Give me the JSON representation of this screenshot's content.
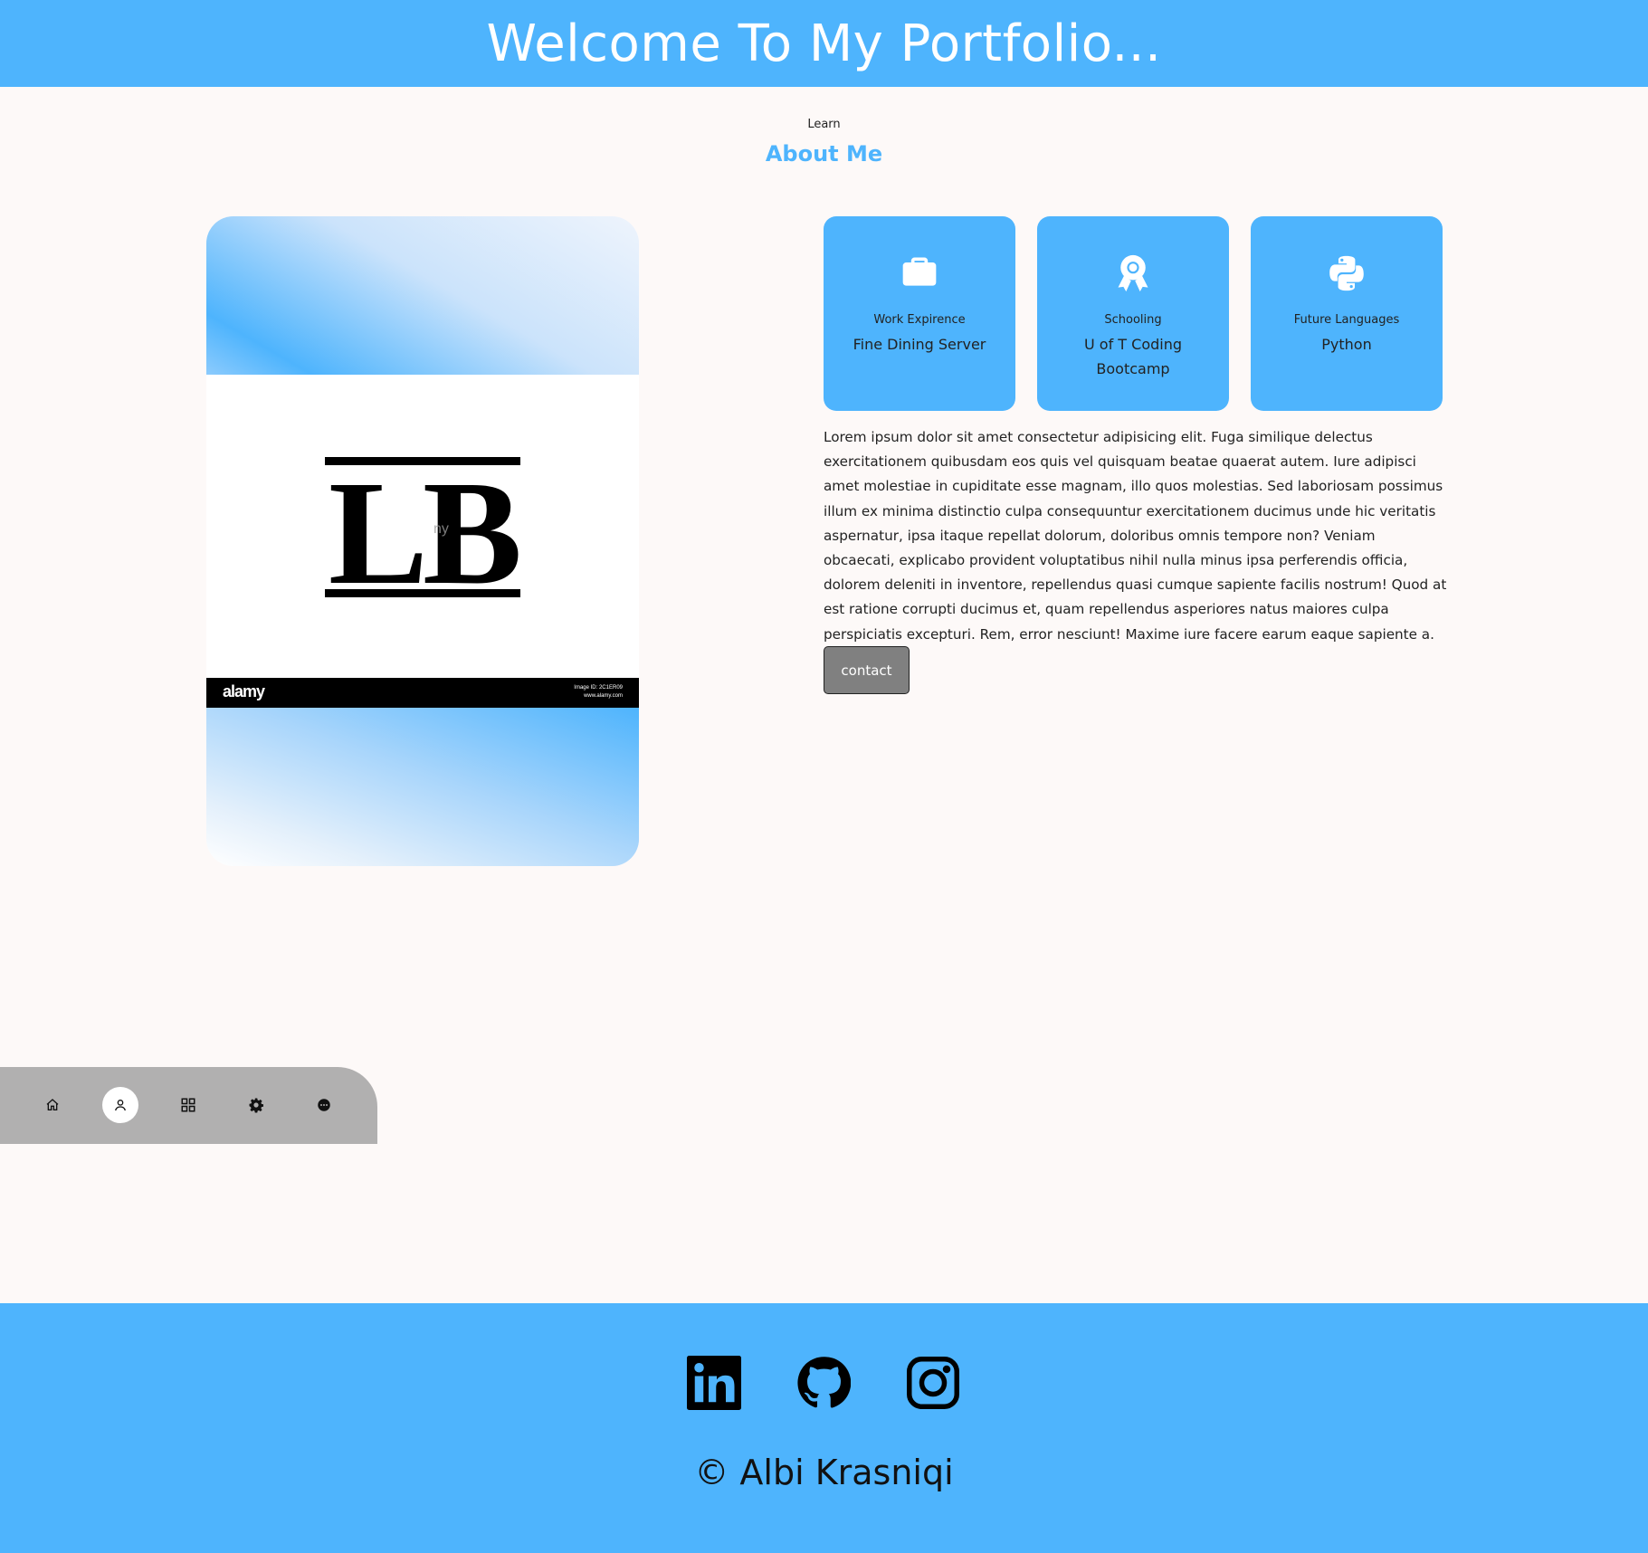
{
  "header": {
    "title": "Welcome To My Portfolio..."
  },
  "about": {
    "kicker": "Learn",
    "title": "About Me",
    "photo": {
      "logo_text": "LB",
      "watermark": "alamy",
      "brand": "alamy",
      "image_id": "Image ID: 2C1ER09",
      "site": "www.alamy.com"
    },
    "cards": [
      {
        "icon": "briefcase-icon",
        "label": "Work Expirence",
        "value": "Fine Dining Server"
      },
      {
        "icon": "award-icon",
        "label": "Schooling",
        "value": "U of T Coding Bootcamp"
      },
      {
        "icon": "python-icon",
        "label": "Future Languages",
        "value": "Python"
      }
    ],
    "bio": "Lorem ipsum dolor sit amet consectetur adipisicing elit. Fuga similique delectus exercitationem quibusdam eos quis vel quisquam beatae quaerat autem. Iure adipisci amet molestiae in cupiditate esse magnam, illo quos molestias. Sed laboriosam possimus illum ex minima distinctio culpa consequuntur exercitationem ducimus unde hic veritatis aspernatur, ipsa itaque repellat dolorum, doloribus omnis tempore non? Veniam obcaecati, explicabo provident voluptatibus nihil nulla minus ipsa perferendis officia, dolorem deleniti in inventore, repellendus quasi cumque sapiente facilis nostrum! Quod at est ratione corrupti ducimus et, quam repellendus asperiores natus maiores culpa perspiciatis excepturi. Rem, error nesciunt! Maxime iure facere earum eaque sapiente a.",
    "contact_label": "contact"
  },
  "dock": {
    "items": [
      {
        "icon": "home-icon",
        "active": false
      },
      {
        "icon": "user-icon",
        "active": true
      },
      {
        "icon": "grid-icon",
        "active": false
      },
      {
        "icon": "gear-icon",
        "active": false
      },
      {
        "icon": "chat-icon",
        "active": false
      }
    ]
  },
  "footer": {
    "socials": [
      "linkedin-icon",
      "github-icon",
      "instagram-icon"
    ],
    "copyright": "© Albi Krasniqi"
  },
  "colors": {
    "accent": "#4eb4fd",
    "page_bg": "#fdf9f8",
    "dock_bg": "#b1b0b0",
    "button_bg": "#808080"
  }
}
